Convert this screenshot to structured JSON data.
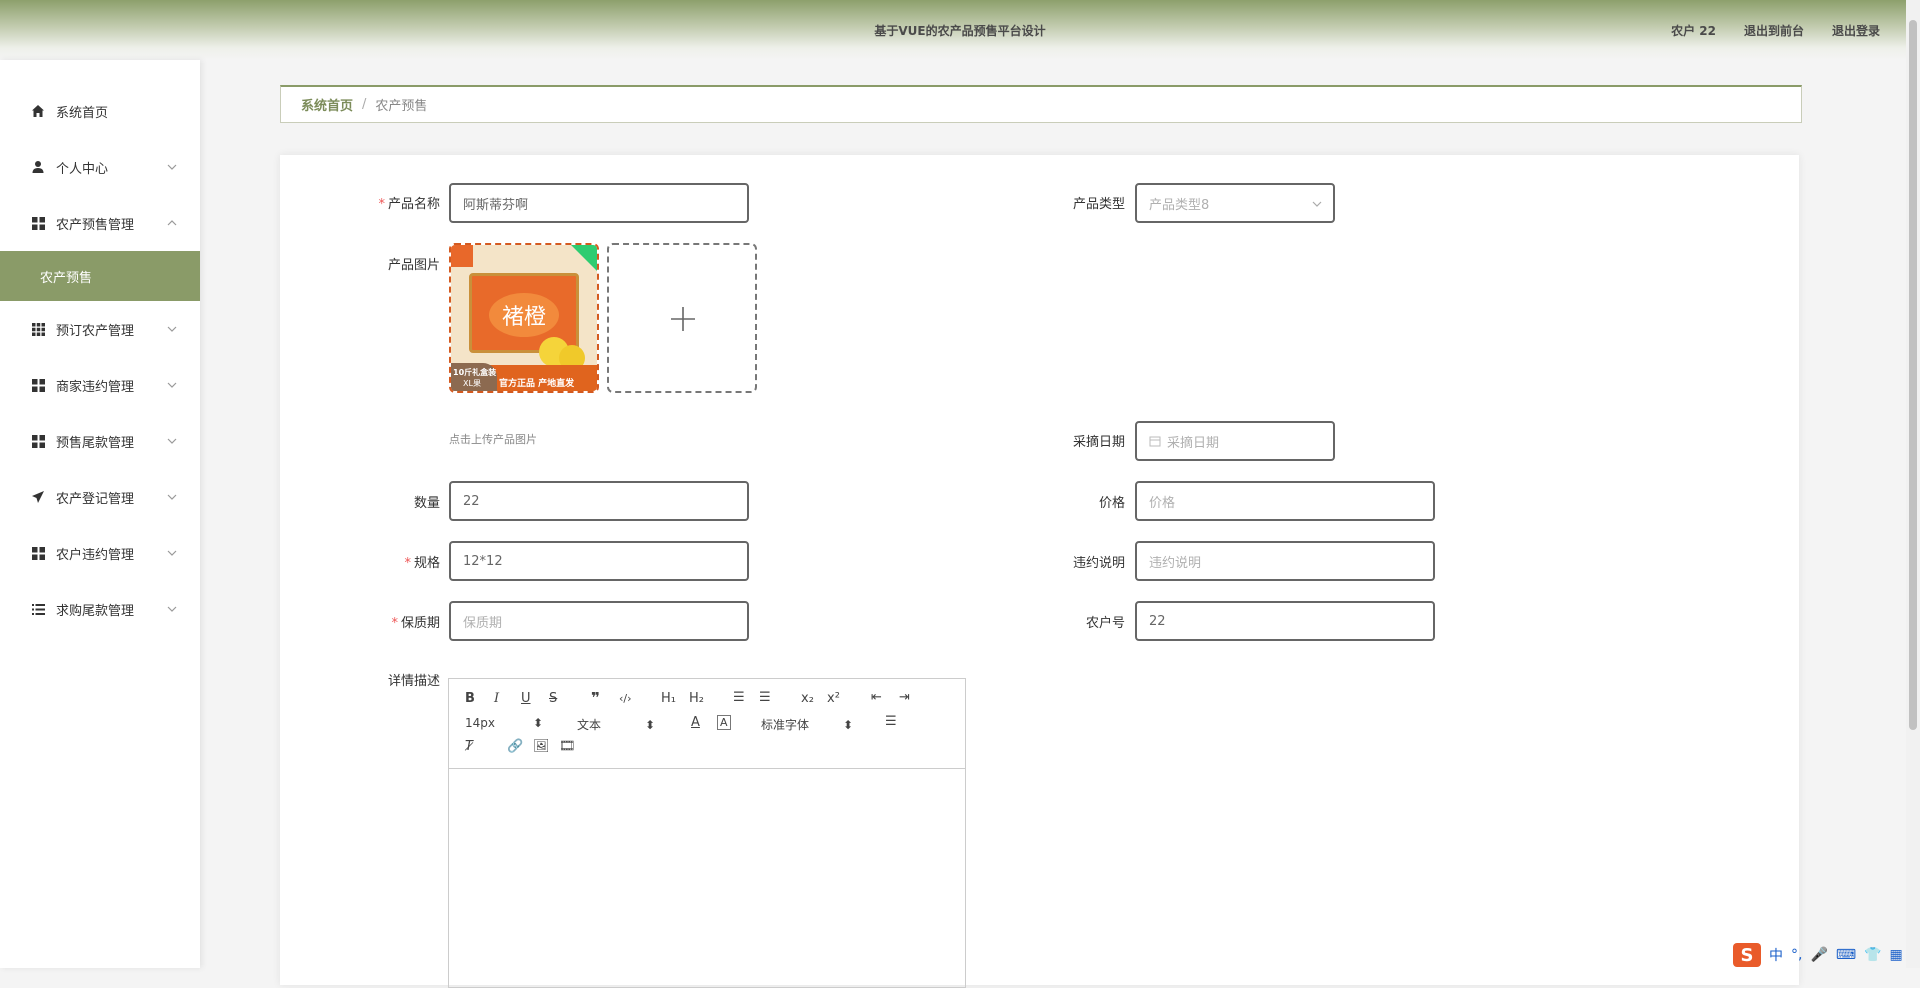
{
  "header": {
    "title": "基于VUE的农产品预售平台设计",
    "user": "农户 22",
    "back_front": "退出到前台",
    "logout": "退出登录"
  },
  "sidebar": {
    "items": [
      {
        "label": "系统首页",
        "icon": "home-icon"
      },
      {
        "label": "个人中心",
        "icon": "user-icon"
      },
      {
        "label": "农产预售管理",
        "icon": "grid-icon"
      },
      {
        "label": "预订农产管理",
        "icon": "grid9-icon"
      },
      {
        "label": "商家违约管理",
        "icon": "grid-icon"
      },
      {
        "label": "预售尾款管理",
        "icon": "grid-icon"
      },
      {
        "label": "农产登记管理",
        "icon": "send-icon"
      },
      {
        "label": "农户违约管理",
        "icon": "grid-icon"
      },
      {
        "label": "求购尾款管理",
        "icon": "list-icon"
      }
    ],
    "active_sub": "农产预售"
  },
  "breadcrumb": {
    "home": "系统首页",
    "separator": "/",
    "current": "农产预售"
  },
  "form": {
    "product_name": {
      "label": "产品名称",
      "value": "阿斯蒂芬啊"
    },
    "product_type": {
      "label": "产品类型",
      "value": "产品类型8"
    },
    "product_image": {
      "label": "产品图片",
      "hint": "点击上传产品图片",
      "image_text_1": "10斤礼盒装",
      "image_text_2": "XL果",
      "image_text_3": "官方正品 产地直发",
      "image_text_4": "褚橙"
    },
    "pick_date": {
      "label": "采摘日期",
      "placeholder": "采摘日期"
    },
    "quantity": {
      "label": "数量",
      "value": "22"
    },
    "price": {
      "label": "价格",
      "placeholder": "价格"
    },
    "spec": {
      "label": "规格",
      "value": "12*12"
    },
    "breach_note": {
      "label": "违约说明",
      "placeholder": "违约说明"
    },
    "shelf_life": {
      "label": "保质期",
      "placeholder": "保质期"
    },
    "farmer_no": {
      "label": "农户号",
      "value": "22"
    },
    "detail": {
      "label": "详情描述"
    }
  },
  "editor": {
    "font_size": "14px",
    "text_type": "文本",
    "font_family": "标准字体"
  },
  "ime": {
    "lang": "中",
    "logo": "S"
  },
  "colors": {
    "accent": "#8a9b68",
    "required": "#e55555"
  }
}
